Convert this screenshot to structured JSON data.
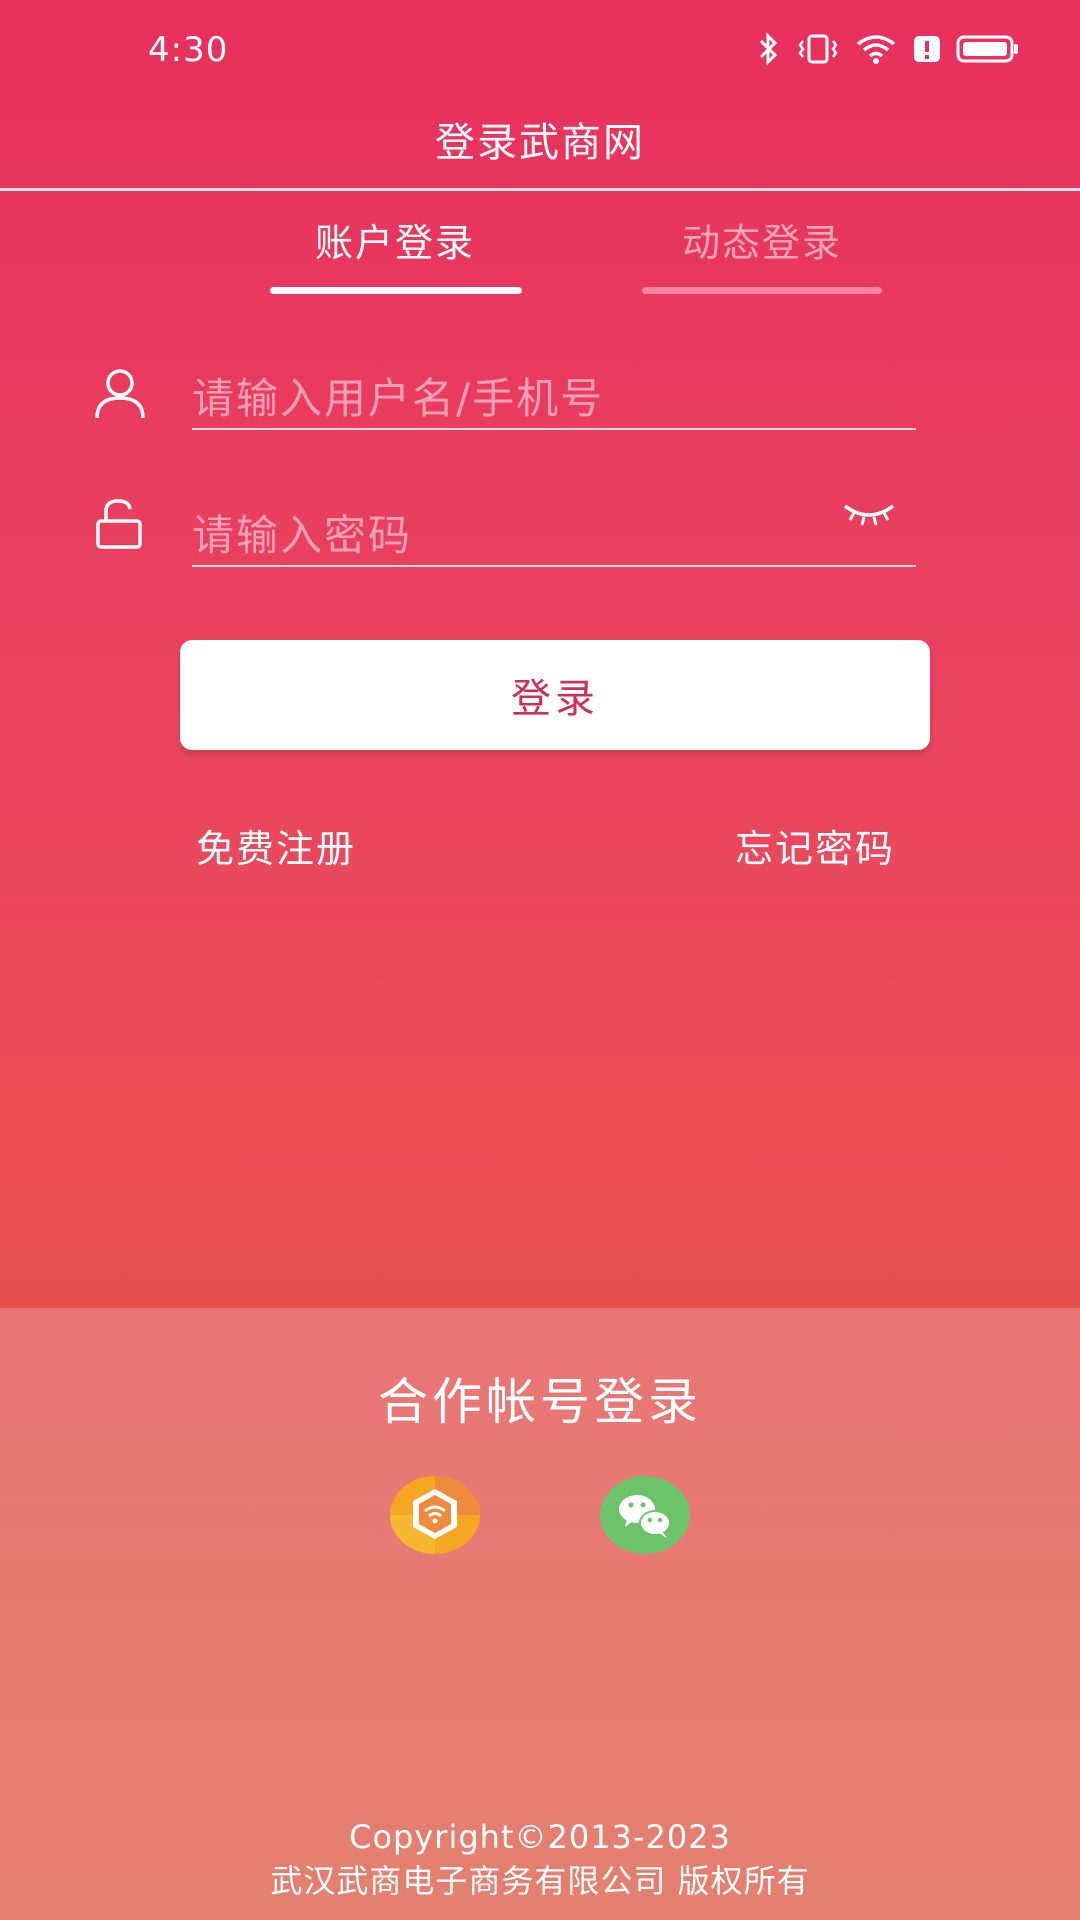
{
  "status_bar": {
    "time": "4:30"
  },
  "header": {
    "title": "登录武商网"
  },
  "tabs": [
    {
      "label": "账户登录",
      "active": true
    },
    {
      "label": "动态登录",
      "active": false
    }
  ],
  "form": {
    "username_placeholder": "请输入用户名/手机号",
    "password_placeholder": "请输入密码",
    "login_label": "登录"
  },
  "links": {
    "register": "免费注册",
    "forgot": "忘记密码"
  },
  "partner": {
    "title": "合作帐号登录",
    "providers": [
      {
        "icon": "wushang-logo-icon"
      },
      {
        "icon": "wechat-icon"
      }
    ]
  },
  "footer": {
    "copyright": "Copyright©2013-2023",
    "company": "武汉武商电子商务有限公司 版权所有"
  },
  "colors": {
    "background_top": "#e8305e",
    "background_mid": "#ec4e58",
    "partner_panel": "#e67a73",
    "login_button_text": "#cc2f57",
    "inactive_tab": "#f8a5b8"
  }
}
